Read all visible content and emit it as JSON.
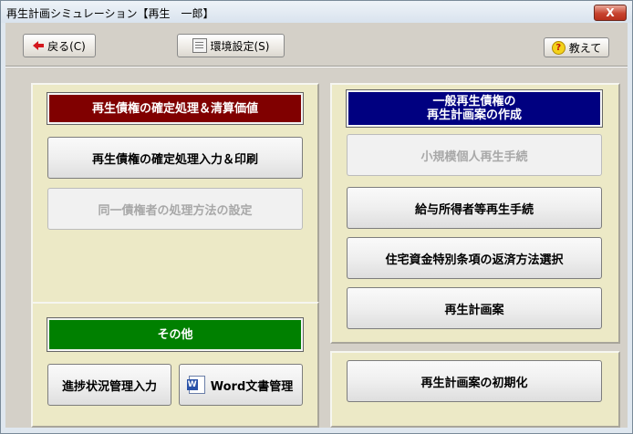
{
  "window": {
    "title": "再生計画シミュレーション【再生　一郎】",
    "close_label": "X"
  },
  "toolbar": {
    "back_label": "戻る(C)",
    "settings_label": "環境設定(S)",
    "help_label": "教えて"
  },
  "left_panel": {
    "header": "再生債権の確定処理＆清算価値",
    "btn_confirm_input": "再生債権の確定処理入力＆印刷",
    "btn_same_creditor": "同一債権者の処理方法の設定"
  },
  "other_panel": {
    "header": "その他",
    "btn_progress": "進捗状況管理入力",
    "btn_word": "Word文書管理"
  },
  "right_panel": {
    "header_line1": "一般再生債権の",
    "header_line2": "再生計画案の作成",
    "btn_small_scale": "小規模個人再生手続",
    "btn_salary": "給与所得者等再生手続",
    "btn_housing": "住宅資金特別条項の返済方法選択",
    "btn_plan": "再生計画案"
  },
  "init_panel": {
    "btn_init": "再生計画案の初期化"
  },
  "icons": {
    "back": "back-arrow-icon",
    "settings": "settings-icon",
    "help": "help-icon",
    "word": "word-icon"
  },
  "colors": {
    "red_header": "#800000",
    "blue_header": "#000080",
    "green_header": "#008000"
  }
}
